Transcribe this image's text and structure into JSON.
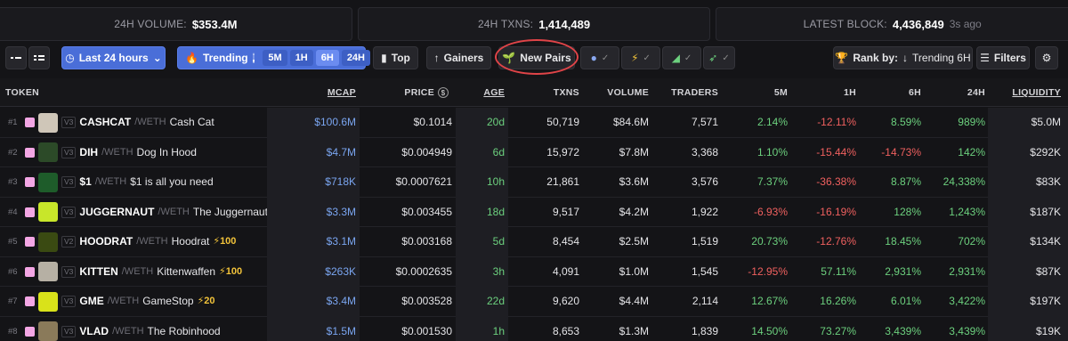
{
  "stats": [
    {
      "label": "24H VOLUME:",
      "value": "$353.4M",
      "sub": ""
    },
    {
      "label": "24H TXNS:",
      "value": "1,414,489",
      "sub": ""
    },
    {
      "label": "LATEST BLOCK:",
      "value": "4,436,849",
      "sub": "3s ago"
    }
  ],
  "toolbar": {
    "timeframe": "Last 24 hours",
    "trending": "Trending",
    "trending_periods": [
      "5M",
      "1H",
      "6H",
      "24H"
    ],
    "top": "Top",
    "gainers": "Gainers",
    "new_pairs": "New Pairs",
    "rank_by_label": "Rank by:",
    "rank_by_value": "Trending 6H",
    "filters": "Filters"
  },
  "columns": {
    "token": "TOKEN",
    "mcap": "MCAP",
    "price": "PRICE",
    "age": "AGE",
    "txns": "TXNS",
    "volume": "VOLUME",
    "traders": "TRADERS",
    "m5": "5M",
    "h1": "1H",
    "h6": "6H",
    "h24": "24H",
    "liquidity": "LIQUIDITY"
  },
  "rows": [
    {
      "rank": "#1",
      "ver": "V3",
      "symbol": "CASHCAT",
      "quote": "/WETH",
      "name": "Cash Cat",
      "boost": "",
      "mcap": "$100.6M",
      "price": "$0.1014",
      "age": "20d",
      "txns": "50,719",
      "volume": "$84.6M",
      "traders": "7,571",
      "m5": "2.14%",
      "h1": "-12.11%",
      "h6": "8.59%",
      "h24": "989%",
      "liquidity": "$5.0M",
      "avatar_color": "#cfc6b8"
    },
    {
      "rank": "#2",
      "ver": "V3",
      "symbol": "DIH",
      "quote": "/WETH",
      "name": "Dog In Hood",
      "boost": "",
      "mcap": "$4.7M",
      "price": "$0.004949",
      "age": "6d",
      "txns": "15,972",
      "volume": "$7.8M",
      "traders": "3,368",
      "m5": "1.10%",
      "h1": "-15.44%",
      "h6": "-14.73%",
      "h24": "142%",
      "liquidity": "$292K",
      "avatar_color": "#2c4a28"
    },
    {
      "rank": "#3",
      "ver": "V3",
      "symbol": "$1",
      "quote": "/WETH",
      "name": "$1 is all you need",
      "boost": "",
      "mcap": "$718K",
      "price": "$0.0007621",
      "age": "10h",
      "txns": "21,861",
      "volume": "$3.6M",
      "traders": "3,576",
      "m5": "7.37%",
      "h1": "-36.38%",
      "h6": "8.87%",
      "h24": "24,338%",
      "liquidity": "$83K",
      "avatar_color": "#1e5c2a"
    },
    {
      "rank": "#4",
      "ver": "V3",
      "symbol": "JUGGERNAUT",
      "quote": "/WETH",
      "name": "The Juggernaut",
      "boost": "",
      "mcap": "$3.3M",
      "price": "$0.003455",
      "age": "18d",
      "txns": "9,517",
      "volume": "$4.2M",
      "traders": "1,922",
      "m5": "-6.93%",
      "h1": "-16.19%",
      "h6": "128%",
      "h24": "1,243%",
      "liquidity": "$187K",
      "avatar_color": "#c8e62a"
    },
    {
      "rank": "#5",
      "ver": "V2",
      "symbol": "HOODRAT",
      "quote": "/WETH",
      "name": "Hoodrat",
      "boost": "⚡100",
      "mcap": "$3.1M",
      "price": "$0.003168",
      "age": "5d",
      "txns": "8,454",
      "volume": "$2.5M",
      "traders": "1,519",
      "m5": "20.73%",
      "h1": "-12.76%",
      "h6": "18.45%",
      "h24": "702%",
      "liquidity": "$134K",
      "avatar_color": "#3a4a12"
    },
    {
      "rank": "#6",
      "ver": "V3",
      "symbol": "KITTEN",
      "quote": "/WETH",
      "name": "Kittenwaffen",
      "boost": "⚡100",
      "mcap": "$263K",
      "price": "$0.0002635",
      "age": "3h",
      "txns": "4,091",
      "volume": "$1.0M",
      "traders": "1,545",
      "m5": "-12.95%",
      "h1": "57.11%",
      "h6": "2,931%",
      "h24": "2,931%",
      "liquidity": "$87K",
      "avatar_color": "#b6b0a4"
    },
    {
      "rank": "#7",
      "ver": "V3",
      "symbol": "GME",
      "quote": "/WETH",
      "name": "GameStop",
      "boost": "⚡20",
      "mcap": "$3.4M",
      "price": "$0.003528",
      "age": "22d",
      "txns": "9,620",
      "volume": "$4.4M",
      "traders": "2,114",
      "m5": "12.67%",
      "h1": "16.26%",
      "h6": "6.01%",
      "h24": "3,422%",
      "liquidity": "$197K",
      "avatar_color": "#d9e21a"
    },
    {
      "rank": "#8",
      "ver": "V3",
      "symbol": "VLAD",
      "quote": "/WETH",
      "name": "The Robinhood",
      "boost": "",
      "mcap": "$1.5M",
      "price": "$0.001530",
      "age": "1h",
      "txns": "8,653",
      "volume": "$1.3M",
      "traders": "1,839",
      "m5": "14.50%",
      "h1": "73.27%",
      "h6": "3,439%",
      "h24": "3,439%",
      "liquidity": "$19K",
      "avatar_color": "#8a7a5a"
    }
  ]
}
